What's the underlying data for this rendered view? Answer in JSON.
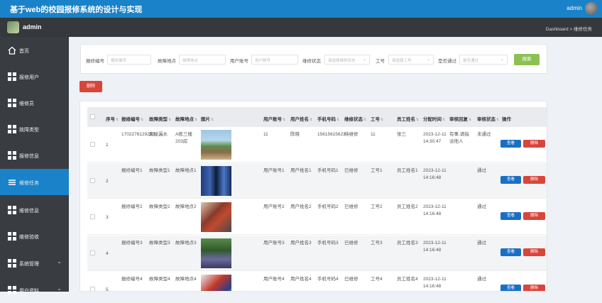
{
  "app": {
    "title": "基于web的校园报修系统的设计与实现",
    "user": "admin"
  },
  "subbar": {
    "admin_name": "admin",
    "breadcrumb": "Dashboard > 维修任务"
  },
  "sidebar": {
    "items": [
      {
        "label": "首页",
        "icon": "home-icon"
      },
      {
        "label": "报修用户",
        "icon": "grid-icon"
      },
      {
        "label": "维修员",
        "icon": "grid-icon"
      },
      {
        "label": "故障类型",
        "icon": "grid-icon"
      },
      {
        "label": "报修信息",
        "icon": "grid-icon"
      },
      {
        "label": "维修任务",
        "icon": "list-icon",
        "active": true
      },
      {
        "label": "维修信息",
        "icon": "grid-icon"
      },
      {
        "label": "维修验收",
        "icon": "grid-icon"
      },
      {
        "label": "系统管理",
        "icon": "grid-icon",
        "chevron": "⌄"
      },
      {
        "label": "用户资料",
        "icon": "grid-icon",
        "chevron": "⌄"
      }
    ]
  },
  "search": {
    "fields": [
      {
        "label": "报修编号",
        "placeholder": "报修编号"
      },
      {
        "label": "故障地点",
        "placeholder": "故障地点"
      },
      {
        "label": "用户账号",
        "placeholder": "用户账号"
      },
      {
        "label": "维修状态",
        "placeholder": "请选择维修状态",
        "dropdown": "⌄"
      },
      {
        "label": "工号",
        "placeholder": "请选择工号",
        "dropdown": "⌄"
      },
      {
        "label": "是否通过",
        "placeholder": "是否通过",
        "dropdown": "⌄"
      }
    ],
    "search_button": "搜索"
  },
  "delete_button": "删除",
  "table": {
    "columns": [
      "序号",
      "报修编号",
      "故障类型",
      "故障地点",
      "图片",
      "用户账号",
      "用户姓名",
      "手机号码",
      "维修状态",
      "工号",
      "员工姓名",
      "分配时间",
      "审核回复",
      "审核状态",
      "操作"
    ],
    "view_label": "查看",
    "delete_label": "删除",
    "rows": [
      {
        "no": "1",
        "code": "1702276129283",
        "type": "房屋漏水",
        "place": "A栋三楼203房",
        "user": "11",
        "name": "陈晓",
        "phone": "15615615623",
        "status": "待维修",
        "emp_no": "11",
        "emp_name": "张三",
        "time": "2023-12-11 14:30:47",
        "reply": "有事,请指派他人",
        "audit": "未通过",
        "img": "campus"
      },
      {
        "no": "2",
        "code": "报修编号1",
        "type": "故障类型1",
        "place": "故障地点1",
        "user": "用户账号1",
        "name": "用户姓名1",
        "phone": "手机号码1",
        "status": "已维修",
        "emp_no": "工号1",
        "emp_name": "员工姓名1",
        "time": "2023-12-11 14:16:48",
        "reply": "",
        "audit": "通过",
        "img": "blue"
      },
      {
        "no": "3",
        "code": "报修编号2",
        "type": "故障类型2",
        "place": "故障地点2",
        "user": "用户账号2",
        "name": "用户姓名2",
        "phone": "手机号码2",
        "status": "已维修",
        "emp_no": "工号2",
        "emp_name": "员工姓名2",
        "time": "2023-12-11 14:16:48",
        "reply": "",
        "audit": "通过",
        "img": "red"
      },
      {
        "no": "4",
        "code": "报修编号3",
        "type": "故障类型3",
        "place": "故障地点3",
        "user": "用户账号3",
        "name": "用户姓名3",
        "phone": "手机号码3",
        "status": "已维修",
        "emp_no": "工号3",
        "emp_name": "员工姓名3",
        "time": "2023-12-11 14:16:48",
        "reply": "",
        "audit": "通过",
        "img": "green"
      },
      {
        "no": "5",
        "code": "报修编号4",
        "type": "故障类型4",
        "place": "故障地点4",
        "user": "用户账号4",
        "name": "用户姓名4",
        "phone": "手机号码4",
        "status": "已维修",
        "emp_no": "工号4",
        "emp_name": "员工姓名4",
        "time": "2023-12-11 14:16:48",
        "reply": "",
        "audit": "通过",
        "img": "worker"
      }
    ]
  },
  "colors": {
    "primary": "#1a82c8",
    "sidebar": "#393d42",
    "search_btn": "#8cc152",
    "danger": "#d9443b",
    "view_btn": "#1a6fc4"
  }
}
